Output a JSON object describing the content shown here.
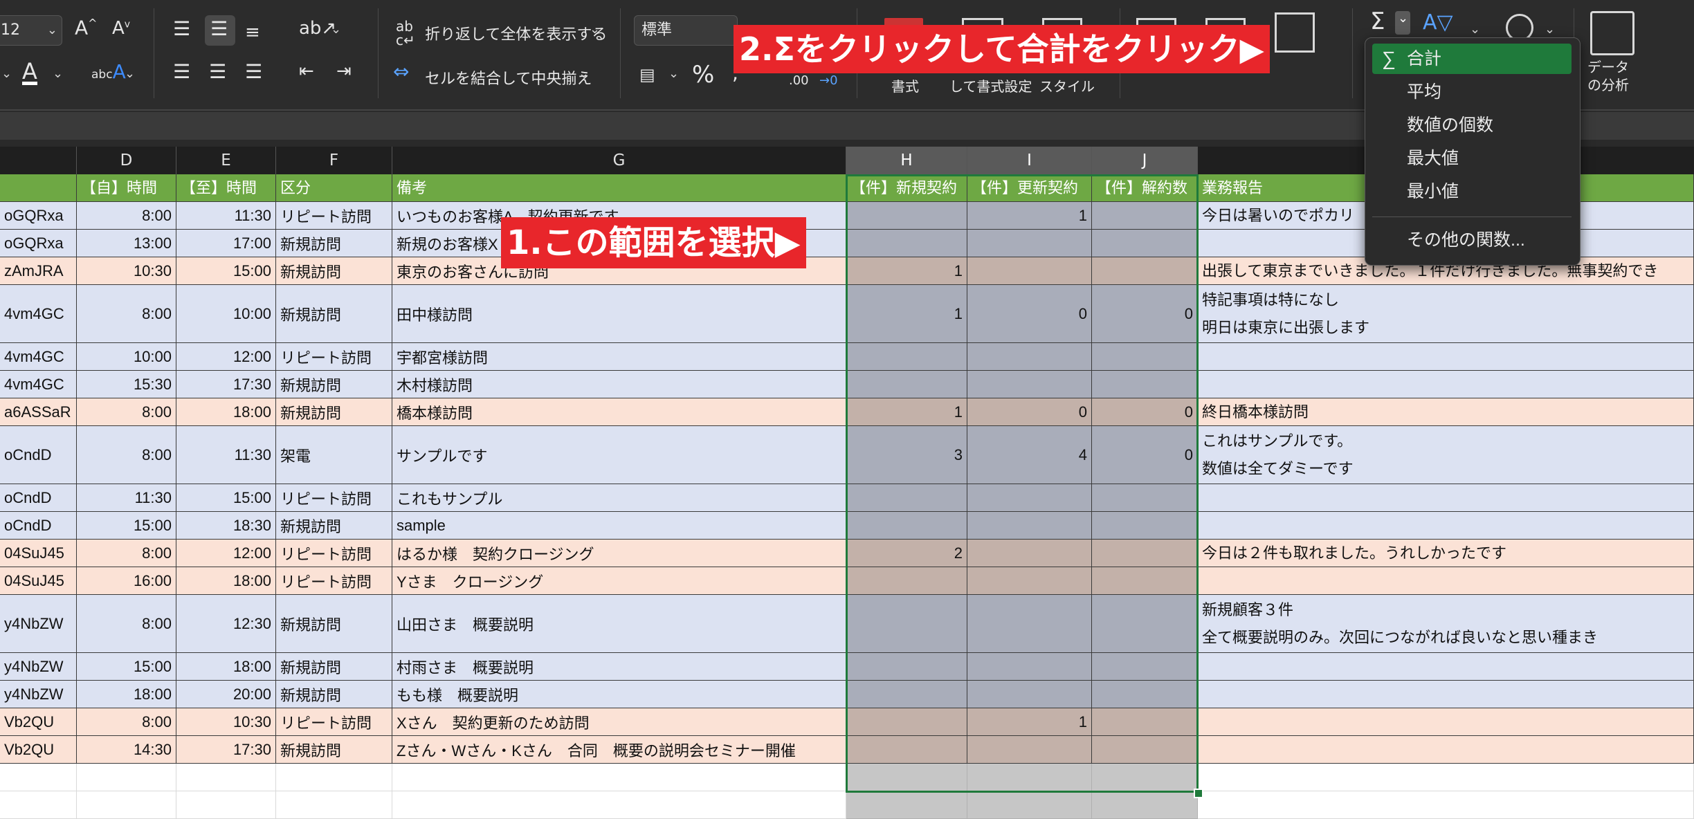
{
  "ribbon": {
    "font_size": "12",
    "number_format": "標準",
    "wrap_text_label": "折り返して全体を表示する",
    "merge_center_label": "セルを結合して中央揃え",
    "cond_format_label": "書式",
    "format_as_table_label": "して書式設定",
    "cell_styles_label": "スタイル",
    "analyze_line1": "データ",
    "analyze_line2": "の分析",
    "decimal_label": ".00",
    "decimal_arrow_label": "→0",
    "percent_label": "%",
    "accent_color": "#1f7a3b"
  },
  "columns": [
    "D",
    "E",
    "F",
    "G",
    "H",
    "I",
    "J"
  ],
  "headers": {
    "c": "",
    "d": "【自】時間",
    "e": "【至】時間",
    "f": "区分",
    "g": "備考",
    "h": "【件】新規契約",
    "i": "【件】更新契約",
    "j": "【件】解約数",
    "k": "業務報告"
  },
  "rows": [
    {
      "c": "oGQRxa",
      "d": "8:00",
      "e": "11:30",
      "f": "リピート訪問",
      "g": "いつものお客様A　契約更新です",
      "h": "",
      "i": "1",
      "j": "",
      "k1": "今日は暑いのでポカリ",
      "k2": ""
    },
    {
      "c": "oGQRxa",
      "d": "13:00",
      "e": "17:00",
      "f": "新規訪問",
      "g": "新規のお客様X",
      "h": "",
      "i": "",
      "j": "",
      "k1": "",
      "k2": ""
    },
    {
      "c": "zAmJRA",
      "d": "10:30",
      "e": "15:00",
      "f": "新規訪問",
      "g": "東京のお客さんに訪問",
      "h": "1",
      "i": "",
      "j": "",
      "k1": "出張して東京までいきました。１件だけ行きました。無事契約でき",
      "k2": ""
    },
    {
      "c": "4vm4GC",
      "d": "8:00",
      "e": "10:00",
      "f": "新規訪問",
      "g": "田中様訪問",
      "h": "1",
      "i": "0",
      "j": "0",
      "k1": "特記事項は特になし",
      "k2": "明日は東京に出張します"
    },
    {
      "c": "4vm4GC",
      "d": "10:00",
      "e": "12:00",
      "f": "リピート訪問",
      "g": "宇都宮様訪問",
      "h": "",
      "i": "",
      "j": "",
      "k1": "",
      "k2": ""
    },
    {
      "c": "4vm4GC",
      "d": "15:30",
      "e": "17:30",
      "f": "新規訪問",
      "g": "木村様訪問",
      "h": "",
      "i": "",
      "j": "",
      "k1": "",
      "k2": ""
    },
    {
      "c": "a6ASSaR",
      "d": "8:00",
      "e": "18:00",
      "f": "新規訪問",
      "g": "橋本様訪問",
      "h": "1",
      "i": "0",
      "j": "0",
      "k1": "終日橋本様訪問",
      "k2": ""
    },
    {
      "c": "oCndD",
      "d": "8:00",
      "e": "11:30",
      "f": "架電",
      "g": "サンプルです",
      "h": "3",
      "i": "4",
      "j": "0",
      "k1": "これはサンプルです。",
      "k2": "数値は全てダミーです"
    },
    {
      "c": "oCndD",
      "d": "11:30",
      "e": "15:00",
      "f": "リピート訪問",
      "g": "これもサンプル",
      "h": "",
      "i": "",
      "j": "",
      "k1": "",
      "k2": ""
    },
    {
      "c": "oCndD",
      "d": "15:00",
      "e": "18:30",
      "f": "新規訪問",
      "g": "sample",
      "h": "",
      "i": "",
      "j": "",
      "k1": "",
      "k2": ""
    },
    {
      "c": "04SuJ45",
      "d": "8:00",
      "e": "12:00",
      "f": "リピート訪問",
      "g": "はるか様　契約クロージング",
      "h": "2",
      "i": "",
      "j": "",
      "k1": "今日は２件も取れました。うれしかったです",
      "k2": ""
    },
    {
      "c": "04SuJ45",
      "d": "16:00",
      "e": "18:00",
      "f": "リピート訪問",
      "g": "Yさま　クロージング",
      "h": "",
      "i": "",
      "j": "",
      "k1": "",
      "k2": ""
    },
    {
      "c": "y4NbZW",
      "d": "8:00",
      "e": "12:30",
      "f": "新規訪問",
      "g": "山田さま　概要説明",
      "h": "",
      "i": "",
      "j": "",
      "k1": "新規顧客３件",
      "k2": "全て概要説明のみ。次回につながれば良いなと思い種まき"
    },
    {
      "c": "y4NbZW",
      "d": "15:00",
      "e": "18:00",
      "f": "新規訪問",
      "g": "村雨さま　概要説明",
      "h": "",
      "i": "",
      "j": "",
      "k1": "",
      "k2": ""
    },
    {
      "c": "y4NbZW",
      "d": "18:00",
      "e": "20:00",
      "f": "新規訪問",
      "g": "もも様　概要説明",
      "h": "",
      "i": "",
      "j": "",
      "k1": "",
      "k2": ""
    },
    {
      "c": "Vb2QU",
      "d": "8:00",
      "e": "10:30",
      "f": "リピート訪問",
      "g": "Xさん　契約更新のため訪問",
      "h": "",
      "i": "1",
      "j": "",
      "k1": "",
      "k2": ""
    },
    {
      "c": "Vb2QU",
      "d": "14:30",
      "e": "17:30",
      "f": "新規訪問",
      "g": "Zさん・Wさん・Kさん　合同　概要の説明会セミナー開催",
      "h": "",
      "i": "",
      "j": "",
      "k1": "",
      "k2": ""
    }
  ],
  "annotations": {
    "step1": "1.この範囲を選択▶",
    "step2": "2.Σをクリックして合計をクリック▶"
  },
  "menu": {
    "items": [
      "合計",
      "平均",
      "数値の個数",
      "最大値",
      "最小値",
      "その他の関数..."
    ]
  }
}
